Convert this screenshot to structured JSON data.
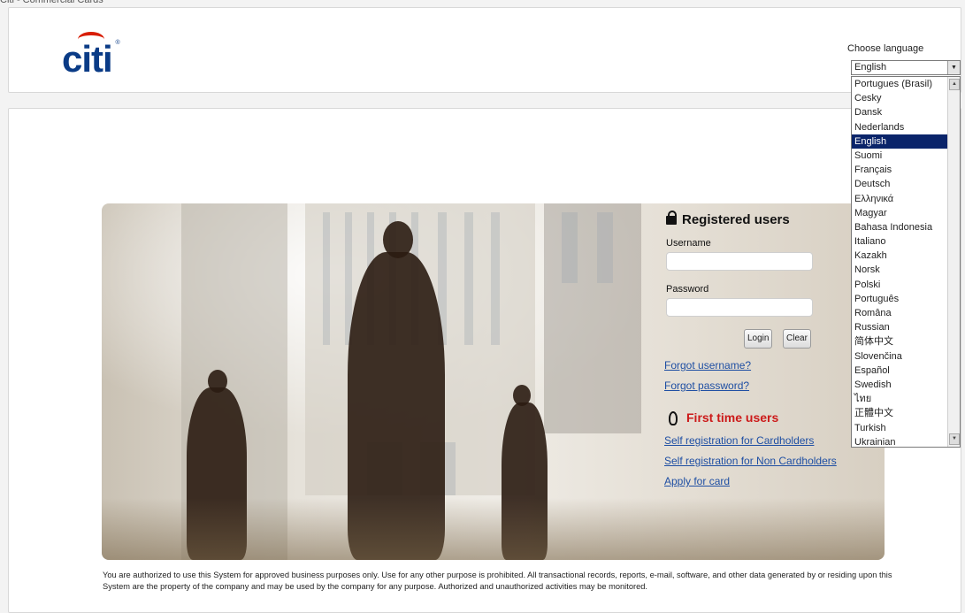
{
  "window": {
    "tab_title": "Citi - Commercial Cards"
  },
  "header": {
    "logo_text": "citi",
    "language_label": "Choose language",
    "language_selected": "English",
    "language_options": [
      "Portugues (Brasil)",
      "Cesky",
      "Dansk",
      "Nederlands",
      "English",
      "Suomi",
      "Français",
      "Deutsch",
      "Ελληνικά",
      "Magyar",
      "Bahasa Indonesia",
      "Italiano",
      "Kazakh",
      "Norsk",
      "Polski",
      "Português",
      "Româna",
      "Russian",
      "简体中文",
      "Slovenčina",
      "Español",
      "Swedish",
      "ไทย",
      "正體中文",
      "Turkish",
      "Ukrainian"
    ],
    "selected_index": 4
  },
  "login": {
    "title": "Registered users",
    "username_label": "Username",
    "password_label": "Password",
    "username_value": "",
    "password_value": "",
    "login_button": "Login",
    "clear_button": "Clear",
    "forgot_username": "Forgot username?",
    "forgot_password": "Forgot password?"
  },
  "first_time": {
    "title": "First time users",
    "links": [
      "Self registration for Cardholders",
      "Self registration for Non Cardholders",
      "Apply for card"
    ]
  },
  "footer": {
    "disclaimer": "You are authorized to use this System for approved business purposes only. Use for any other purpose is prohibited. All transactional records, reports, e-mail, software, and other data generated by or residing upon this System are the property of the company and may be used by the company for any purpose. Authorized and unauthorized activities may be monitored."
  },
  "colors": {
    "brand_blue": "#0a3b86",
    "brand_red": "#d81e05",
    "link_blue": "#1f4fa3",
    "selection": "#0a246a",
    "first_time_red": "#cc1a1a"
  }
}
